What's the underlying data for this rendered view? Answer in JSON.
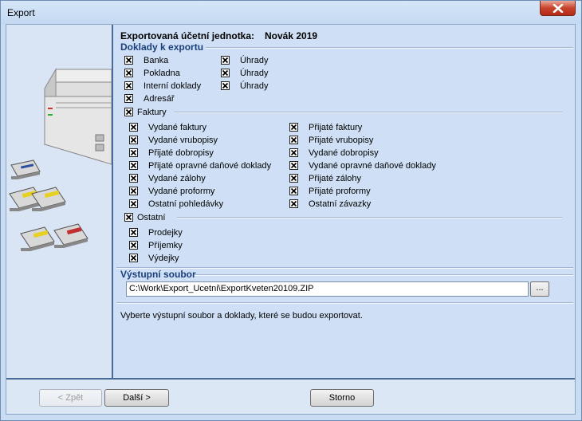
{
  "window": {
    "title": "Export"
  },
  "header": {
    "label": "Exportovaná účetní jednotka:",
    "value": "Novák 2019"
  },
  "documents": {
    "title": "Doklady k exportu",
    "col1": [
      {
        "label": "Banka",
        "checked": true
      },
      {
        "label": "Pokladna",
        "checked": true
      },
      {
        "label": "Interní doklady",
        "checked": true
      },
      {
        "label": "Adresář",
        "checked": true
      }
    ],
    "col2": [
      {
        "label": "Úhrady",
        "checked": true
      },
      {
        "label": "Úhrady",
        "checked": true
      },
      {
        "label": "Úhrady",
        "checked": true
      }
    ]
  },
  "invoices": {
    "title": "Faktury",
    "checked": true,
    "left": [
      {
        "label": "Vydané faktury",
        "checked": true
      },
      {
        "label": "Vydané vrubopisy",
        "checked": true
      },
      {
        "label": "Přijaté dobropisy",
        "checked": true
      },
      {
        "label": "Přijaté opravné daňové doklady",
        "checked": true
      },
      {
        "label": "Vydané zálohy",
        "checked": true
      },
      {
        "label": "Vydané proformy",
        "checked": true
      },
      {
        "label": "Ostatní pohledávky",
        "checked": true
      }
    ],
    "right": [
      {
        "label": "Přijaté faktury",
        "checked": true
      },
      {
        "label": "Přijaté vrubopisy",
        "checked": true
      },
      {
        "label": "Vydané dobropisy",
        "checked": true
      },
      {
        "label": "Vydané opravné daňové doklady",
        "checked": true
      },
      {
        "label": "Přijaté zálohy",
        "checked": true
      },
      {
        "label": "Přijaté proformy",
        "checked": true
      },
      {
        "label": "Ostatní závazky",
        "checked": true
      }
    ]
  },
  "other": {
    "title": "Ostatní",
    "checked": true,
    "items": [
      {
        "label": "Prodejky",
        "checked": true
      },
      {
        "label": "Příjemky",
        "checked": true
      },
      {
        "label": "Výdejky",
        "checked": true
      }
    ]
  },
  "output": {
    "title": "Výstupní soubor",
    "path": "C:\\Work\\Export_Ucetni\\ExportKveten20109.ZIP",
    "browse_label": "..."
  },
  "hint": "Vyberte výstupní soubor a doklady, které se budou exportovat.",
  "buttons": {
    "back": "< Zpět",
    "next": "Další >",
    "cancel": "Storno"
  }
}
